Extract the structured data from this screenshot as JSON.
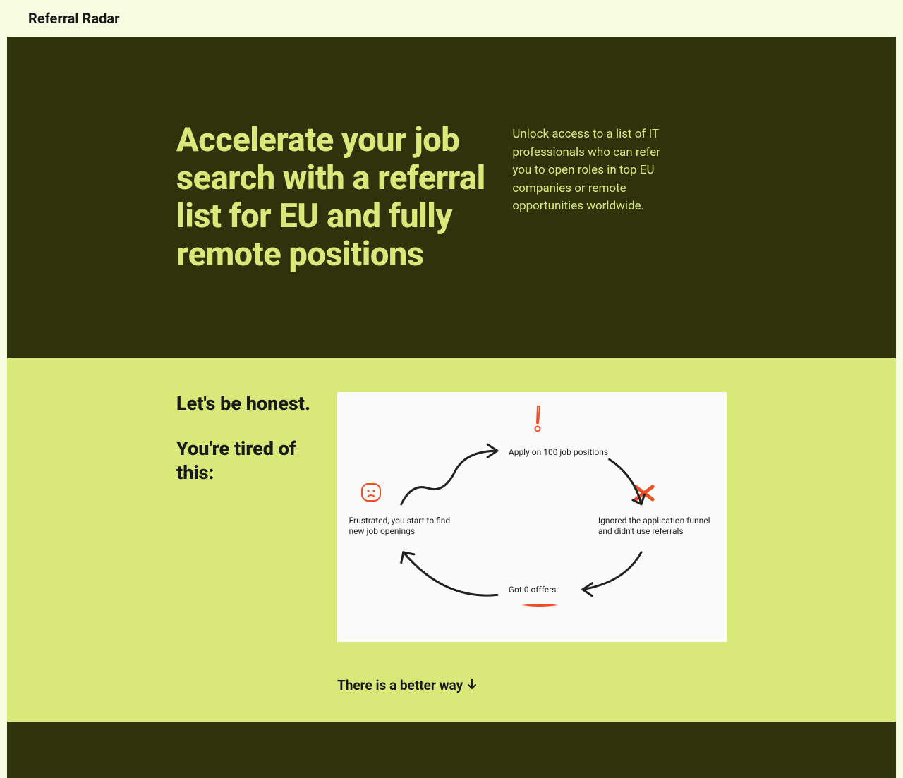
{
  "brand": "Referral Radar",
  "hero": {
    "title": "Accelerate your job search with a referral list for EU and fully remote positions",
    "subtitle": "Unlock access to a list of IT professionals who can refer you to open roles in top EU companies or remote opportunities worldwide."
  },
  "honest": {
    "line1": "Let's be honest.",
    "line2": "You're tired of this:",
    "diagram": {
      "apply": "Apply on 100 job positions",
      "ignored": "Ignored the application funnel and didn't use referrals",
      "offers": "Got 0 offfers",
      "frustrated": "Frustrated, you start to find new job openings"
    },
    "better_way": "There is a better way"
  },
  "colors": {
    "dark": "#2e330c",
    "light": "#d8e97a",
    "cream": "#f8fce0",
    "accent": "#f04e23"
  }
}
